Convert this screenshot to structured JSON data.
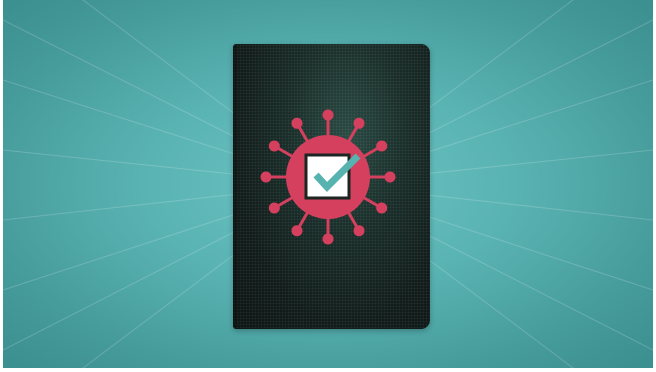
{
  "colors": {
    "background": "#5ab3b3",
    "passport_cover": "#16231f",
    "virus": "#d5405f",
    "check_box": "#ffffff",
    "check_mark": "#56b3b0"
  },
  "icons": {
    "passport": "passport-icon",
    "virus": "virus-icon",
    "checkbox": "checkbox-checked-icon"
  }
}
